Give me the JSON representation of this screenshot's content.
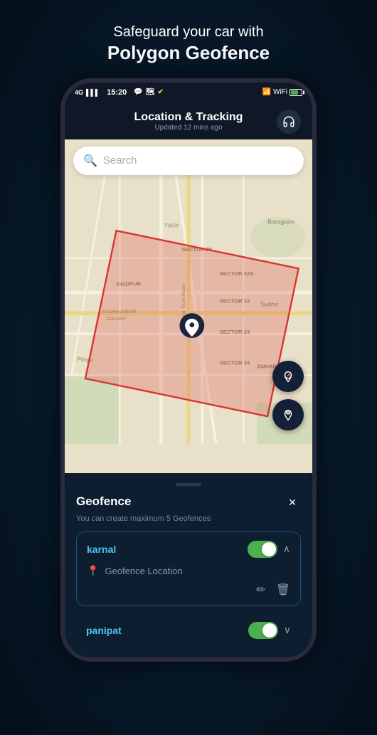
{
  "headline": {
    "top_line": "Safeguard your car with",
    "bold_line": "Polygon Geofence"
  },
  "status_bar": {
    "signal": "4G",
    "time": "15:20",
    "icons": [
      "whatsapp",
      "maps",
      "check"
    ]
  },
  "header": {
    "title": "Location & Tracking",
    "subtitle": "Updated 12 mins ago",
    "icon": "headphone"
  },
  "search": {
    "placeholder": "Search"
  },
  "map_fabs": [
    {
      "icon": "car-location",
      "name": "car-location-fab"
    },
    {
      "icon": "person-location",
      "name": "person-location-fab"
    }
  ],
  "geofence_panel": {
    "title": "Geofence",
    "subtitle": "You can create maximum 5 Geofences",
    "close_label": "×",
    "items": [
      {
        "name": "karnal",
        "enabled": true,
        "expanded": true,
        "location_label": "Geofence Location"
      },
      {
        "name": "panipat",
        "enabled": true,
        "expanded": false
      }
    ]
  }
}
